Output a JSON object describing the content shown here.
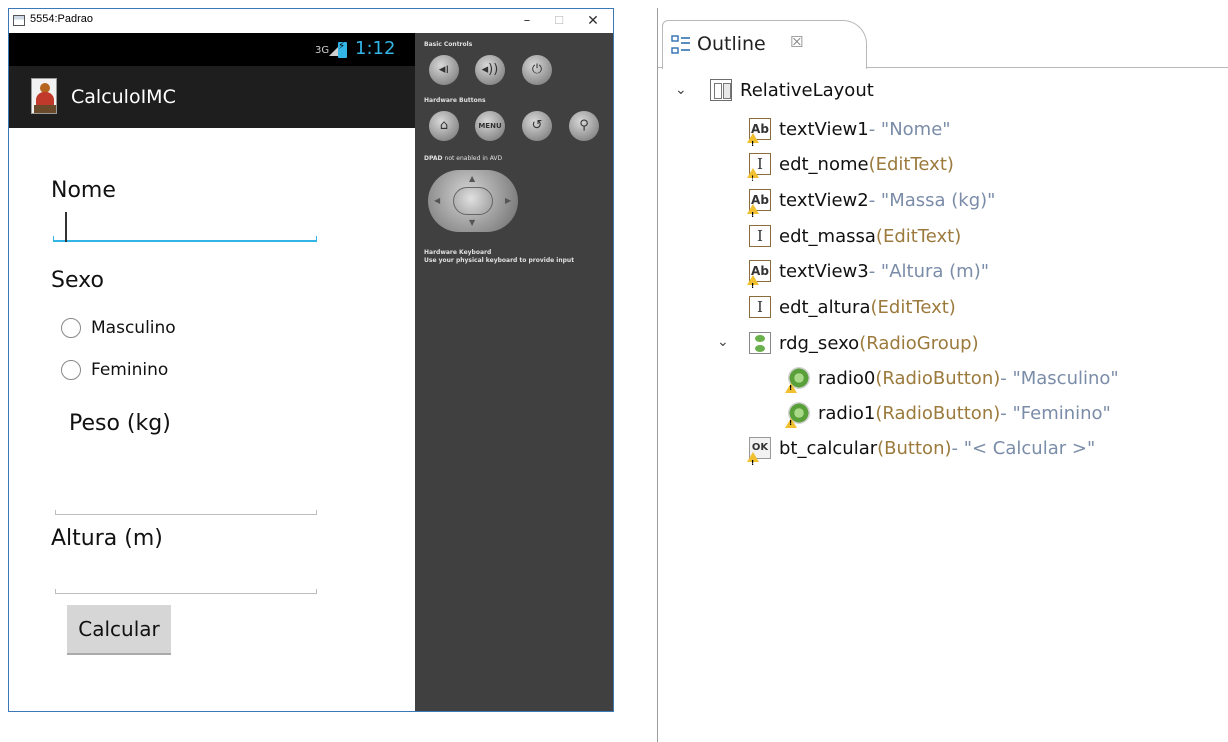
{
  "emulator": {
    "window_title": "5554:Padrao",
    "window_buttons": {
      "minimize": "–",
      "maximize": "☐",
      "close": "✕"
    },
    "status_bar": {
      "network": "3G",
      "time": "1:12"
    },
    "action_bar": {
      "app_title": "CalculoIMC"
    },
    "form": {
      "nome_label": "Nome",
      "sexo_label": "Sexo",
      "radio_options": [
        "Masculino",
        "Feminino"
      ],
      "peso_label": "Peso (kg)",
      "altura_label": "Altura (m)",
      "calcular_button": "Calcular"
    },
    "controls": {
      "basic_controls_label": "Basic Controls",
      "hardware_buttons_label": "Hardware Buttons",
      "menu_button_label": "MENU",
      "dpad_label_prefix": "DPAD",
      "dpad_label_suffix": "not enabled in AVD",
      "keyboard_title": "Hardware Keyboard",
      "keyboard_note": "Use your physical keyboard to provide input"
    }
  },
  "outline": {
    "tab_title": "Outline",
    "tab_close": "☒",
    "tree": [
      {
        "name": "RelativeLayout",
        "type": "",
        "text": ""
      },
      {
        "name": "textView1",
        "type": "",
        "text": " - \"Nome\""
      },
      {
        "name": "edt_nome",
        "type": " (EditText)",
        "text": ""
      },
      {
        "name": "textView2",
        "type": "",
        "text": " - \"Massa (kg)\""
      },
      {
        "name": "edt_massa",
        "type": " (EditText)",
        "text": ""
      },
      {
        "name": "textView3",
        "type": "",
        "text": " - \"Altura (m)\""
      },
      {
        "name": "edt_altura",
        "type": " (EditText)",
        "text": ""
      },
      {
        "name": "rdg_sexo",
        "type": " (RadioGroup)",
        "text": ""
      },
      {
        "name": "radio0",
        "type": " (RadioButton)",
        "text": " - \"Masculino\""
      },
      {
        "name": "radio1",
        "type": " (RadioButton)",
        "text": " - \"Feminino\""
      },
      {
        "name": "bt_calcular",
        "type": " (Button)",
        "text": " - \"< Calcular >\""
      }
    ],
    "icon_labels": {
      "textview": "Ab",
      "edittext": "I",
      "button": "OK"
    }
  }
}
